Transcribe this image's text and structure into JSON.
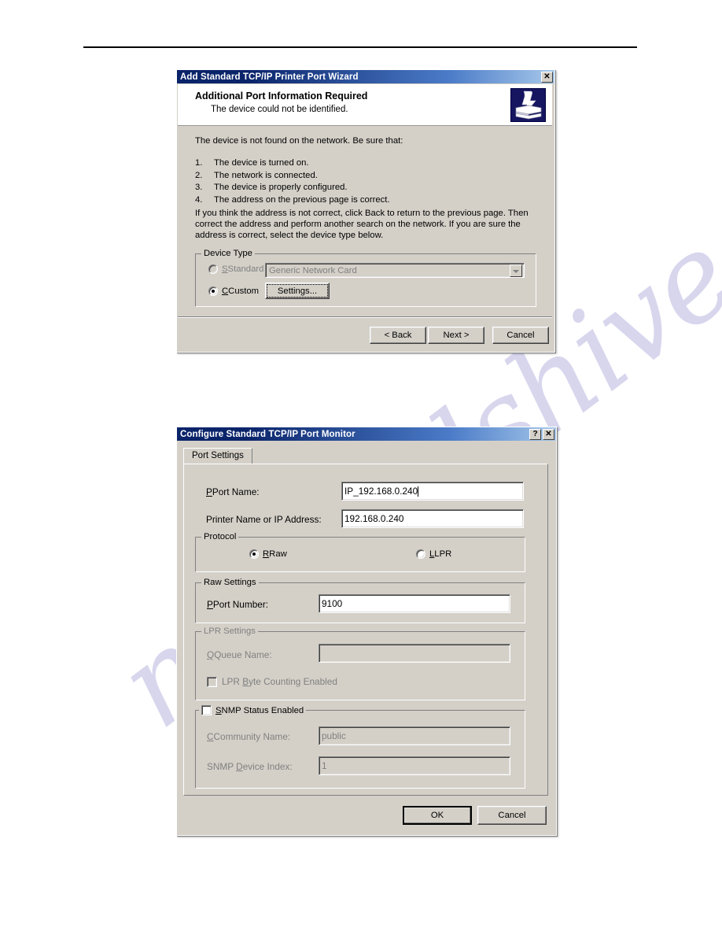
{
  "wizard": {
    "title": "Add Standard TCP/IP Printer Port Wizard",
    "close_label": "✕",
    "heading": "Additional Port Information Required",
    "subheading": "The device could not be identified.",
    "icon": "printer-icon",
    "intro": "The device is not found on the network.  Be sure that:",
    "checklist": [
      {
        "num": "1.",
        "text": "The device is turned on."
      },
      {
        "num": "2.",
        "text": "The network is connected."
      },
      {
        "num": "3.",
        "text": "The device is properly configured."
      },
      {
        "num": "4.",
        "text": "The address on the previous page is correct."
      }
    ],
    "outro": "If you think the address is not correct, click Back to return to the previous page.  Then correct the address and perform another search on the network.  If you are sure the address is correct, select the device type below.",
    "device_type": {
      "legend": "Device Type",
      "standard_label": "Standard",
      "standard_selected": false,
      "standard_combo_value": "Generic Network Card",
      "custom_label": "Custom",
      "custom_selected": true,
      "settings_label": "Settings..."
    },
    "buttons": {
      "back": "< Back",
      "next": "Next >",
      "cancel": "Cancel"
    }
  },
  "portmon": {
    "title": "Configure Standard TCP/IP Port Monitor",
    "help_label": "?",
    "close_label": "✕",
    "tab_label": "Port Settings",
    "port_name_label": "Port Name:",
    "port_name_value": "IP_192.168.0.240",
    "printer_name_label": "Printer Name or IP Address:",
    "printer_name_value": "192.168.0.240",
    "protocol": {
      "legend": "Protocol",
      "raw_label": "Raw",
      "raw_selected": true,
      "lpr_label": "LPR",
      "lpr_selected": false
    },
    "raw_settings": {
      "legend": "Raw Settings",
      "port_number_label": "Port Number:",
      "port_number_value": "9100"
    },
    "lpr_settings": {
      "legend": "LPR Settings",
      "queue_name_label": "Queue Name:",
      "queue_name_value": "",
      "byte_counting_label": "LPR Byte Counting Enabled",
      "byte_counting_checked": false
    },
    "snmp": {
      "legend": "SNMP Status Enabled",
      "enabled": false,
      "community_label": "Community Name:",
      "community_value": "public",
      "device_index_label": "SNMP Device Index:",
      "device_index_value": "1"
    },
    "buttons": {
      "ok": "OK",
      "cancel": "Cancel"
    }
  },
  "watermark": {
    "text": "manualshive.com",
    "color": "#b9b6e0"
  }
}
